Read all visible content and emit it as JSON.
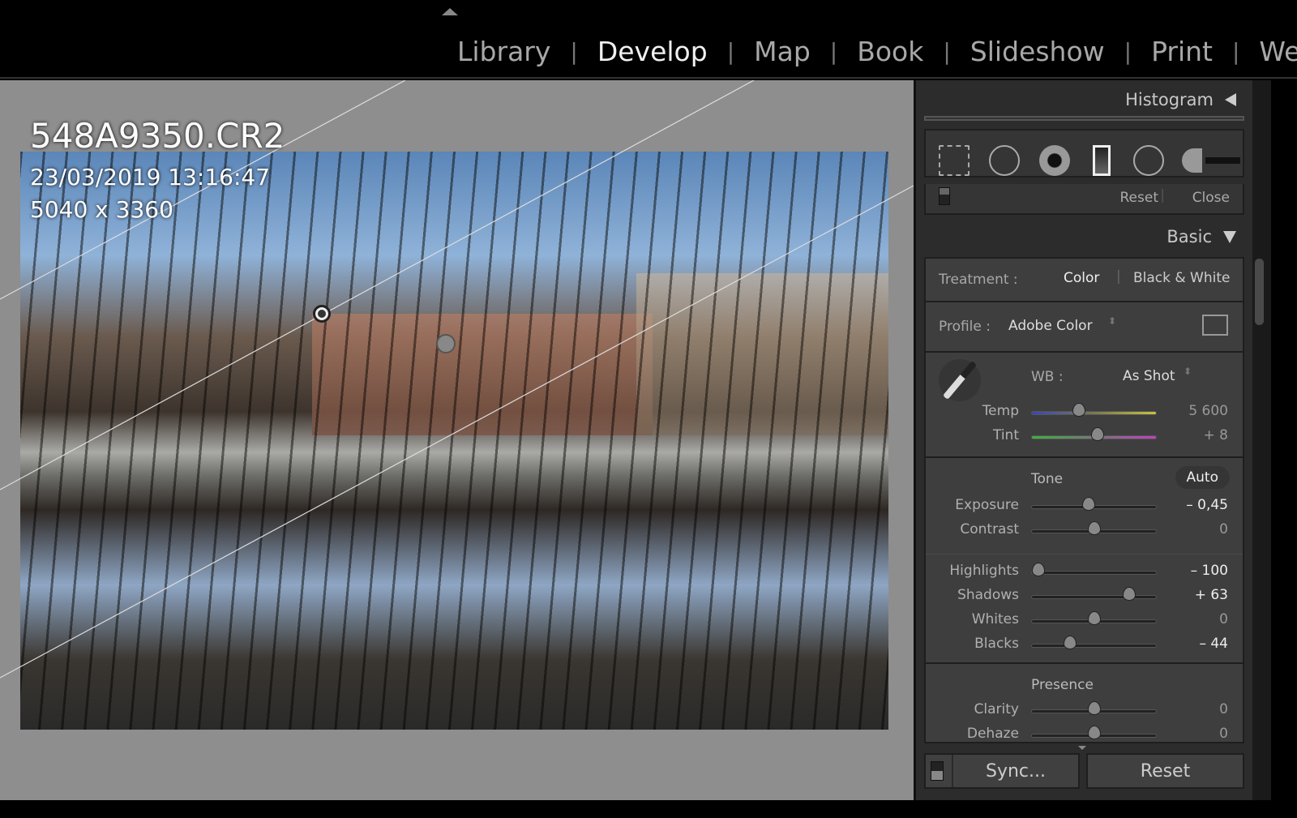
{
  "modules": [
    "Library",
    "Develop",
    "Map",
    "Book",
    "Slideshow",
    "Print",
    "Web"
  ],
  "active_module": "Develop",
  "photo": {
    "filename": "548A9350.CR2",
    "datetime": "23/03/2019 13:16:47",
    "dimensions": "5040 x 3360"
  },
  "panel": {
    "histogram_title": "Histogram",
    "tools": [
      "crop-overlay-icon",
      "spot-removal-icon",
      "red-eye-icon",
      "graduated-filter-icon",
      "radial-filter-icon",
      "adjustment-brush-icon"
    ],
    "mask": {
      "reset": "Reset",
      "close": "Close"
    },
    "basic_title": "Basic",
    "treatment": {
      "label": "Treatment :",
      "color": "Color",
      "bw": "Black & White"
    },
    "profile": {
      "label": "Profile :",
      "value": "Adobe Color"
    },
    "wb": {
      "label": "WB :",
      "value": "As Shot"
    },
    "wb_sliders": [
      {
        "name": "Temp",
        "value": "5 600",
        "pos": 0.38
      },
      {
        "name": "Tint",
        "value": "+ 8",
        "pos": 0.53
      }
    ],
    "tone": {
      "title": "Tone",
      "auto": "Auto"
    },
    "tone_sliders": [
      {
        "name": "Exposure",
        "value": "– 0,45",
        "pos": 0.46,
        "hi": true
      },
      {
        "name": "Contrast",
        "value": "0",
        "pos": 0.5
      }
    ],
    "tone_sliders2": [
      {
        "name": "Highlights",
        "value": "– 100",
        "pos": 0.06,
        "hi": true
      },
      {
        "name": "Shadows",
        "value": "+ 63",
        "pos": 0.78,
        "hi": true
      },
      {
        "name": "Whites",
        "value": "0",
        "pos": 0.5
      },
      {
        "name": "Blacks",
        "value": "– 44",
        "pos": 0.31,
        "hi": true
      }
    ],
    "presence": {
      "title": "Presence"
    },
    "presence_sliders": [
      {
        "name": "Clarity",
        "value": "0",
        "pos": 0.5
      },
      {
        "name": "Dehaze",
        "value": "0",
        "pos": 0.5
      }
    ],
    "sync": "Sync...",
    "reset": "Reset"
  }
}
